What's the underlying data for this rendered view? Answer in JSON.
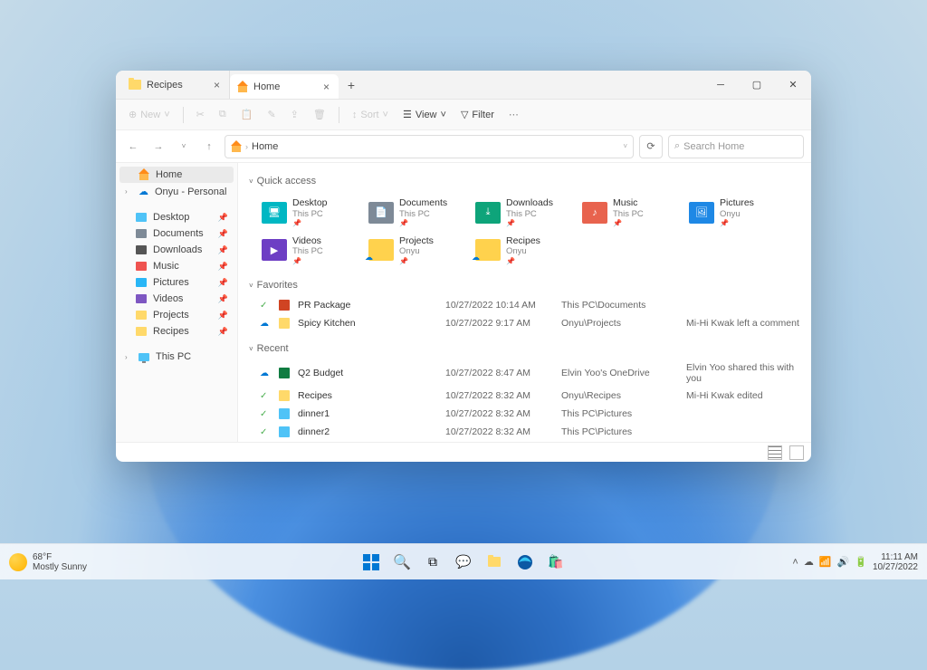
{
  "tabs": [
    {
      "label": "Recipes",
      "active": false
    },
    {
      "label": "Home",
      "active": true
    }
  ],
  "toolbar": {
    "new": "New",
    "sort": "Sort",
    "view": "View",
    "filter": "Filter"
  },
  "breadcrumb": {
    "root_icon": "home",
    "path": "Home"
  },
  "search_placeholder": "Search Home",
  "sidebar": {
    "home": "Home",
    "onyu": "Onyu - Personal",
    "pinned": [
      {
        "name": "Desktop",
        "icon": "desktop",
        "color": "#4fc3f7"
      },
      {
        "name": "Documents",
        "icon": "doc",
        "color": "#7e8a97"
      },
      {
        "name": "Downloads",
        "icon": "down",
        "color": "#555"
      },
      {
        "name": "Music",
        "icon": "music",
        "color": "#ef5350"
      },
      {
        "name": "Pictures",
        "icon": "pic",
        "color": "#29b6f6"
      },
      {
        "name": "Videos",
        "icon": "vid",
        "color": "#7e57c2"
      },
      {
        "name": "Projects",
        "icon": "folder",
        "color": "#ffd96a"
      },
      {
        "name": "Recipes",
        "icon": "folder",
        "color": "#ffd96a"
      }
    ],
    "thispc": "This PC"
  },
  "groups": {
    "quick_access": "Quick access",
    "favorites": "Favorites",
    "recent": "Recent"
  },
  "quick_access": [
    {
      "name": "Desktop",
      "loc": "This PC",
      "color": "#00b7c3",
      "glyph": "🖥"
    },
    {
      "name": "Documents",
      "loc": "This PC",
      "color": "#7e8a97",
      "glyph": "📄"
    },
    {
      "name": "Downloads",
      "loc": "This PC",
      "color": "#0ea47a",
      "glyph": "⤓"
    },
    {
      "name": "Music",
      "loc": "This PC",
      "color": "#e8634e",
      "glyph": "♪"
    },
    {
      "name": "Pictures",
      "loc": "Onyu",
      "color": "#1e88e5",
      "glyph": "🖼"
    },
    {
      "name": "Videos",
      "loc": "This PC",
      "color": "#6d3ec4",
      "glyph": "▶"
    },
    {
      "name": "Projects",
      "loc": "Onyu",
      "color": "#ffd24d",
      "glyph": "",
      "cloud": true
    },
    {
      "name": "Recipes",
      "loc": "Onyu",
      "color": "#ffd24d",
      "glyph": "",
      "cloud": true
    }
  ],
  "favorites": [
    {
      "status": "✓",
      "icon": "ppt",
      "icon_color": "#d04423",
      "name": "PR Package",
      "date": "10/27/2022 10:14 AM",
      "loc": "This PC\\Documents",
      "activity": ""
    },
    {
      "status": "☁",
      "icon": "folder",
      "icon_color": "#ffd96a",
      "name": "Spicy Kitchen",
      "date": "10/27/2022 9:17 AM",
      "loc": "Onyu\\Projects",
      "activity": "Mi-Hi Kwak left a comment"
    }
  ],
  "recent": [
    {
      "status": "☁",
      "icon": "xls",
      "icon_color": "#107c41",
      "name": "Q2 Budget",
      "date": "10/27/2022 8:47 AM",
      "loc": "Elvin Yoo's OneDrive",
      "activity": "Elvin Yoo shared this with you"
    },
    {
      "status": "✓",
      "icon": "folder",
      "icon_color": "#ffd96a",
      "name": "Recipes",
      "date": "10/27/2022 8:32 AM",
      "loc": "Onyu\\Recipes",
      "activity": "Mi-Hi Kwak edited"
    },
    {
      "status": "✓",
      "icon": "img",
      "icon_color": "#4fc3f7",
      "name": "dinner1",
      "date": "10/27/2022 8:32 AM",
      "loc": "This PC\\Pictures",
      "activity": ""
    },
    {
      "status": "✓",
      "icon": "img",
      "icon_color": "#4fc3f7",
      "name": "dinner2",
      "date": "10/27/2022 8:32 AM",
      "loc": "This PC\\Pictures",
      "activity": ""
    }
  ],
  "taskbar": {
    "weather_temp": "68°F",
    "weather_desc": "Mostly Sunny",
    "time": "11:11 AM",
    "date": "10/27/2022"
  }
}
